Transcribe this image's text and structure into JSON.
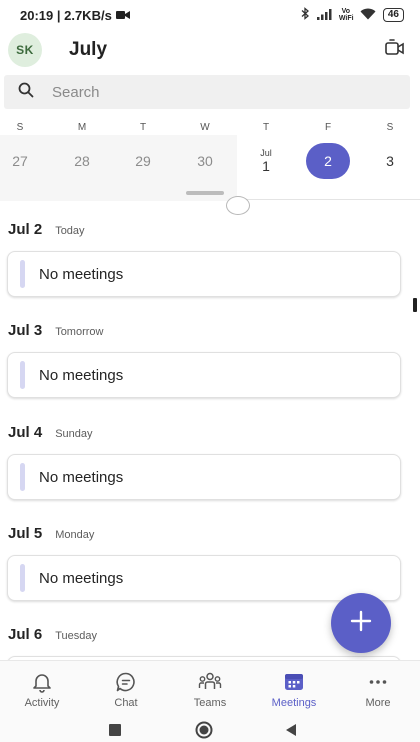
{
  "status_bar": {
    "time_speed": "20:19 | 2.7KB/s",
    "network_label": "Vo WiFi",
    "battery": "46"
  },
  "header": {
    "avatar_initials": "SK",
    "title": "July"
  },
  "search": {
    "placeholder": "Search"
  },
  "week_strip": {
    "days": [
      {
        "dow": "S",
        "date": "27",
        "state": "past"
      },
      {
        "dow": "M",
        "date": "28",
        "state": "past"
      },
      {
        "dow": "T",
        "date": "29",
        "state": "past"
      },
      {
        "dow": "W",
        "date": "30",
        "state": "past"
      },
      {
        "dow": "T",
        "date": "1",
        "month": "Jul",
        "state": "normal"
      },
      {
        "dow": "F",
        "date": "2",
        "state": "selected"
      },
      {
        "dow": "S",
        "date": "3",
        "state": "normal"
      }
    ]
  },
  "agenda": {
    "days": [
      {
        "date": "Jul 2",
        "relative": "Today",
        "event": "No meetings"
      },
      {
        "date": "Jul 3",
        "relative": "Tomorrow",
        "event": "No meetings"
      },
      {
        "date": "Jul 4",
        "relative": "Sunday",
        "event": "No meetings"
      },
      {
        "date": "Jul 5",
        "relative": "Monday",
        "event": "No meetings"
      },
      {
        "date": "Jul 6",
        "relative": "Tuesday",
        "event": ""
      }
    ]
  },
  "bottom_nav": {
    "items": [
      {
        "label": "Activity",
        "icon": "bell-icon",
        "active": false
      },
      {
        "label": "Chat",
        "icon": "chat-icon",
        "active": false
      },
      {
        "label": "Teams",
        "icon": "teams-icon",
        "active": false
      },
      {
        "label": "Meetings",
        "icon": "calendar-icon",
        "active": true
      },
      {
        "label": "More",
        "icon": "more-icon",
        "active": false
      }
    ]
  },
  "colors": {
    "accent": "#5b5fc7",
    "avatar_bg": "#dfeede",
    "card_bar": "#d6d7f2"
  }
}
